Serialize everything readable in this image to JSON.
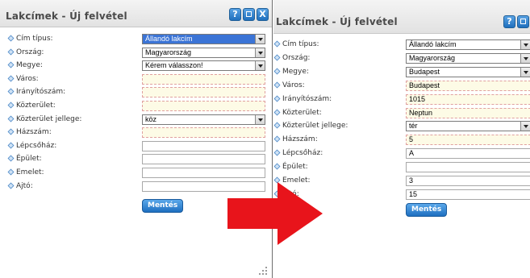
{
  "before": {
    "title": "Lakcímek - Új felvétel",
    "window_buttons": [
      "?",
      "□",
      "X"
    ],
    "fields": [
      {
        "label": "Cím típus:",
        "value": "Állandó lakcím",
        "kind": "select",
        "highlighted": true
      },
      {
        "label": "Ország:",
        "value": "Magyarország",
        "kind": "select"
      },
      {
        "label": "Megye:",
        "value": "Kérem válasszon!",
        "kind": "select"
      },
      {
        "label": "Város:",
        "value": "",
        "kind": "required"
      },
      {
        "label": "Irányítószám:",
        "value": "",
        "kind": "required"
      },
      {
        "label": "Közterület:",
        "value": "",
        "kind": "required"
      },
      {
        "label": "Közterület jellege:",
        "value": "köz",
        "kind": "select"
      },
      {
        "label": "Házszám:",
        "value": "",
        "kind": "required"
      },
      {
        "label": "Lépcsőház:",
        "value": "",
        "kind": "text"
      },
      {
        "label": "Épület:",
        "value": "",
        "kind": "text"
      },
      {
        "label": "Emelet:",
        "value": "",
        "kind": "text"
      },
      {
        "label": "Ajtó:",
        "value": "",
        "kind": "text"
      }
    ],
    "save_label": "Mentés"
  },
  "after": {
    "title": "Lakcímek - Új felvétel",
    "window_buttons": [
      "?",
      "□",
      "X"
    ],
    "fields": [
      {
        "label": "Cím típus:",
        "value": "Állandó lakcím",
        "kind": "select"
      },
      {
        "label": "Ország:",
        "value": "Magyarország",
        "kind": "select"
      },
      {
        "label": "Megye:",
        "value": "Budapest",
        "kind": "select"
      },
      {
        "label": "Város:",
        "value": "Budapest",
        "kind": "required"
      },
      {
        "label": "Irányítószám:",
        "value": "1015",
        "kind": "required"
      },
      {
        "label": "Közterület:",
        "value": "Neptun",
        "kind": "required"
      },
      {
        "label": "Közterület jellege:",
        "value": "tér",
        "kind": "select"
      },
      {
        "label": "Házszám:",
        "value": "5",
        "kind": "required"
      },
      {
        "label": "Lépcsőház:",
        "value": "A",
        "kind": "text"
      },
      {
        "label": "Épület:",
        "value": "",
        "kind": "text"
      },
      {
        "label": "Emelet:",
        "value": "3",
        "kind": "text"
      },
      {
        "label": "Ajtó:",
        "value": "15",
        "kind": "text"
      }
    ],
    "save_label": "Mentés"
  },
  "colors": {
    "arrow": "#e8141b",
    "accent": "#1e6fc0",
    "selection": "#3b74d6"
  },
  "icons": [
    "help-icon",
    "maximize-icon",
    "close-icon",
    "field-bullet-icon",
    "resize-grip-icon",
    "transition-arrow"
  ]
}
